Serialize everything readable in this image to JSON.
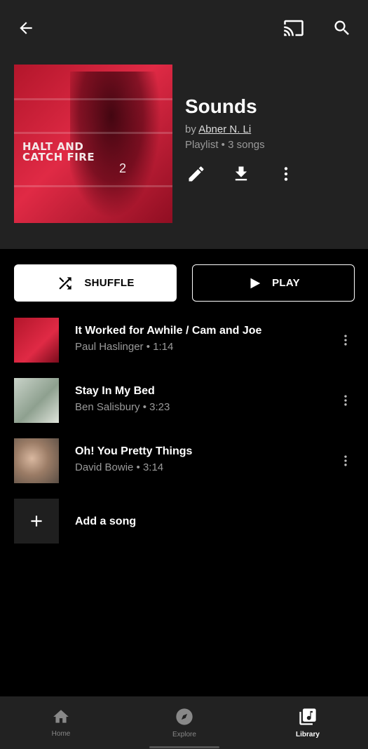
{
  "header": {
    "title": "Sounds",
    "by_prefix": "by",
    "author": "Abner N. Li",
    "meta": "Playlist • 3 songs",
    "cover_text": "HALT AND CATCH FIRE",
    "cover_number": "2"
  },
  "buttons": {
    "shuffle_label": "SHUFFLE",
    "play_label": "PLAY"
  },
  "songs": [
    {
      "title": "It Worked for Awhile / Cam and Joe",
      "subtitle": "Paul Haslinger • 1:14",
      "thumb_text": ""
    },
    {
      "title": "Stay In My Bed",
      "subtitle": "Ben Salisbury • 3:23",
      "thumb_text": ""
    },
    {
      "title": "Oh! You Pretty Things",
      "subtitle": "David Bowie • 3:14",
      "thumb_text": ""
    }
  ],
  "add_song": {
    "label": "Add a song"
  },
  "nav": {
    "home": "Home",
    "explore": "Explore",
    "library": "Library"
  },
  "icons": {
    "back": "arrow-back-icon",
    "cast": "cast-icon",
    "search": "search-icon",
    "edit": "pencil-icon",
    "download": "download-icon",
    "more": "more-vert-icon",
    "shuffle": "shuffle-icon",
    "play": "play-icon",
    "add": "plus-icon"
  },
  "colors": {
    "background": "#000000",
    "header_bg": "#222222",
    "accent_cover": "#e02a45"
  }
}
